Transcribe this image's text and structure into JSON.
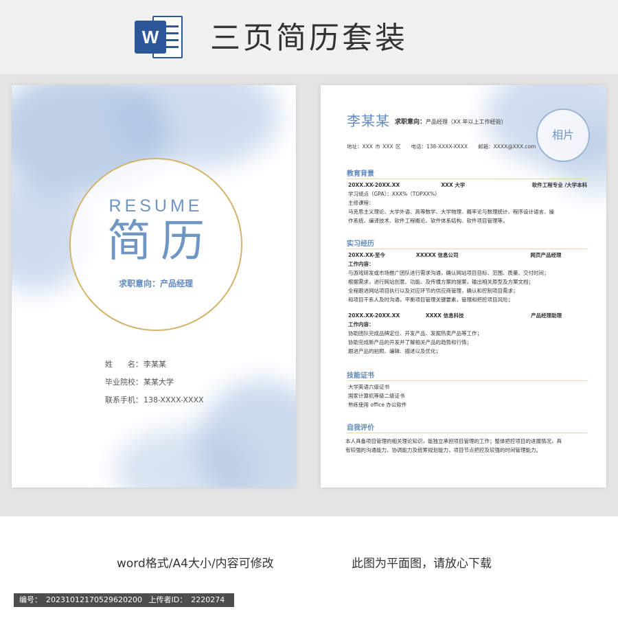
{
  "header": {
    "logo_letter": "W",
    "title": "三页简历套装"
  },
  "cover": {
    "resume_label": "RESUME",
    "title_cn": "简历",
    "intent": "求职意向：产品经理",
    "info": [
      {
        "label": "姓　　名：",
        "value": "李某某"
      },
      {
        "label": "毕业院校：",
        "value": "某某大学"
      },
      {
        "label": "联系手机：",
        "value": "138-XXXX-XXXX"
      }
    ]
  },
  "resume": {
    "name": "李某某",
    "intent_label": "求职意向：",
    "intent_value": "产品经理（XX 年以上工作经验）",
    "contact": "地址：XXX 市 XXX 区　　电话：138-XXXX-XXXX　　邮箱：XXXX@XXX.com",
    "photo_label": "相片",
    "sections": {
      "education": {
        "title": "教育背景",
        "lines": [
          "20XX.XX-20XX.XX　　　　　　　　XXX 大学　　　　　　　　　　　　　软件工程专业 /大学本科",
          "学习绩点（GPA）：XXX%（TOPXX%）",
          "主修课程：",
          "马克思主义理论、大学外语、高等数学、大学物理、概率论与数理统计、程序设计语言、操",
          "作系统、编译技术、软件工程概论、软件体系结构、软件项目管理等。"
        ]
      },
      "internship": {
        "title": "实习经历",
        "lines": [
          "20XX.XX-至今　　　　　　XXXXX 信息公司　　　　　　　　　　　　　　网页产品经理",
          "工作内容：",
          "与游戏研发或市场推广团队进行需求沟通，确认网站项目目标、范围、质量、交付时间；",
          "根据需求，进行网站创意、功能、及传播方案的提案，输出相关原型及方案文档；",
          "全程跟进网站项目执行以及对应环节的供应商管理，确认和控制项目需求；",
          "和项目干系人及时沟通，平衡项目管理关键要素，管理和把控项目风险；",
          "20XX.XX-20XX.XX　　　　　XXXX 信息科技　　　　　　　　　　　　　产品经理助理",
          "工作内容：",
          "协助团队完成品牌定位、开发产品、发掘热卖产品等工作；",
          "协助完成新产品的开发并了解相关产品的趋势和行情；",
          "跟进产品的拍照、编辑、描述以及优化；"
        ]
      },
      "skills": {
        "title": "技能证书",
        "lines": [
          "大学英语六级证书",
          "国家计算机等级二级证书",
          "熟练使用 office 办公软件"
        ]
      },
      "self": {
        "title": "自我评价",
        "lines": [
          "本人具备项目管理的相关理论知识，能独立承担项目管理的工作；整体把控项目的进展情况，具",
          "有较强的沟通能力、协调能力及统筹规划能力，项目节点把控及较强的时间管理能力。"
        ]
      }
    }
  },
  "footer": {
    "format": "word格式/A4大小/内容可修改",
    "note": "此图为平面图，请放心下载",
    "id_label": "编号：",
    "id_value": "20231012170529620200",
    "uploader_label": "上传者ID：",
    "uploader_value": "2220274"
  },
  "colors": {
    "accent_blue": "#5d89bf",
    "gold": "#d4b26a",
    "watercolor": "#a8c0e0"
  }
}
